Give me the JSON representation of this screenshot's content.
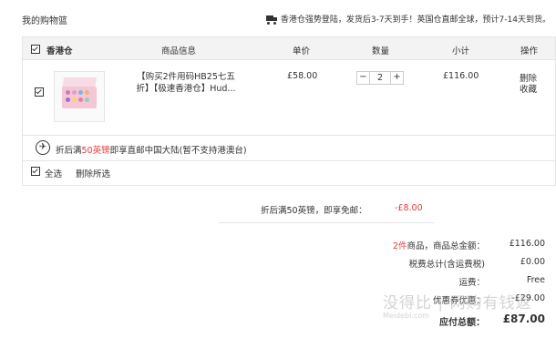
{
  "header": {
    "title": "我的购物篮",
    "shipping_note": "香港仓强势登陆，发货后3-7天到手！英国仓直邮全球，预计7-14天到货。"
  },
  "cart": {
    "columns": {
      "warehouse": "香港仓",
      "product_info": "商品信息",
      "unit_price": "单价",
      "quantity": "数量",
      "subtotal": "小计",
      "actions": "操作"
    },
    "item": {
      "name_line1": "【购买2件用码HB25七五",
      "name_line2": "折】【极速香港仓】Hud...",
      "price": "£58.00",
      "quantity": "2",
      "minus": "−",
      "plus": "+",
      "subtotal": "£116.00",
      "delete": "删除",
      "favorite": "收藏"
    },
    "promo": {
      "prefix": "折后满",
      "amount": "50英镑",
      "suffix": "即享直邮中国大陆(暂不支持港澳台)"
    },
    "footer": {
      "select_all": "全选",
      "delete_selected": "删除所选"
    }
  },
  "discount": {
    "label": "折后满50英镑，即享免邮：",
    "value": "-£8.00"
  },
  "summary": {
    "count": "2件",
    "count_label": "商品，商品总金额：",
    "goods_total": "£116.00",
    "tax_label": "税费总计(含运费税)",
    "tax": "£0.00",
    "shipping_label": "运费：",
    "shipping": "Free",
    "coupon_label": "优惠券优惠：",
    "coupon": "-£29.00",
    "total_label": "应付总额：",
    "total": "£87.00"
  },
  "watermark": {
    "main": "没得比 | 网购有钱返",
    "sub": "Meidebi.com"
  },
  "colors": {
    "accent_red": "#e4393c",
    "header_bg": "#f3f3f3",
    "border": "#e4e4e4"
  }
}
